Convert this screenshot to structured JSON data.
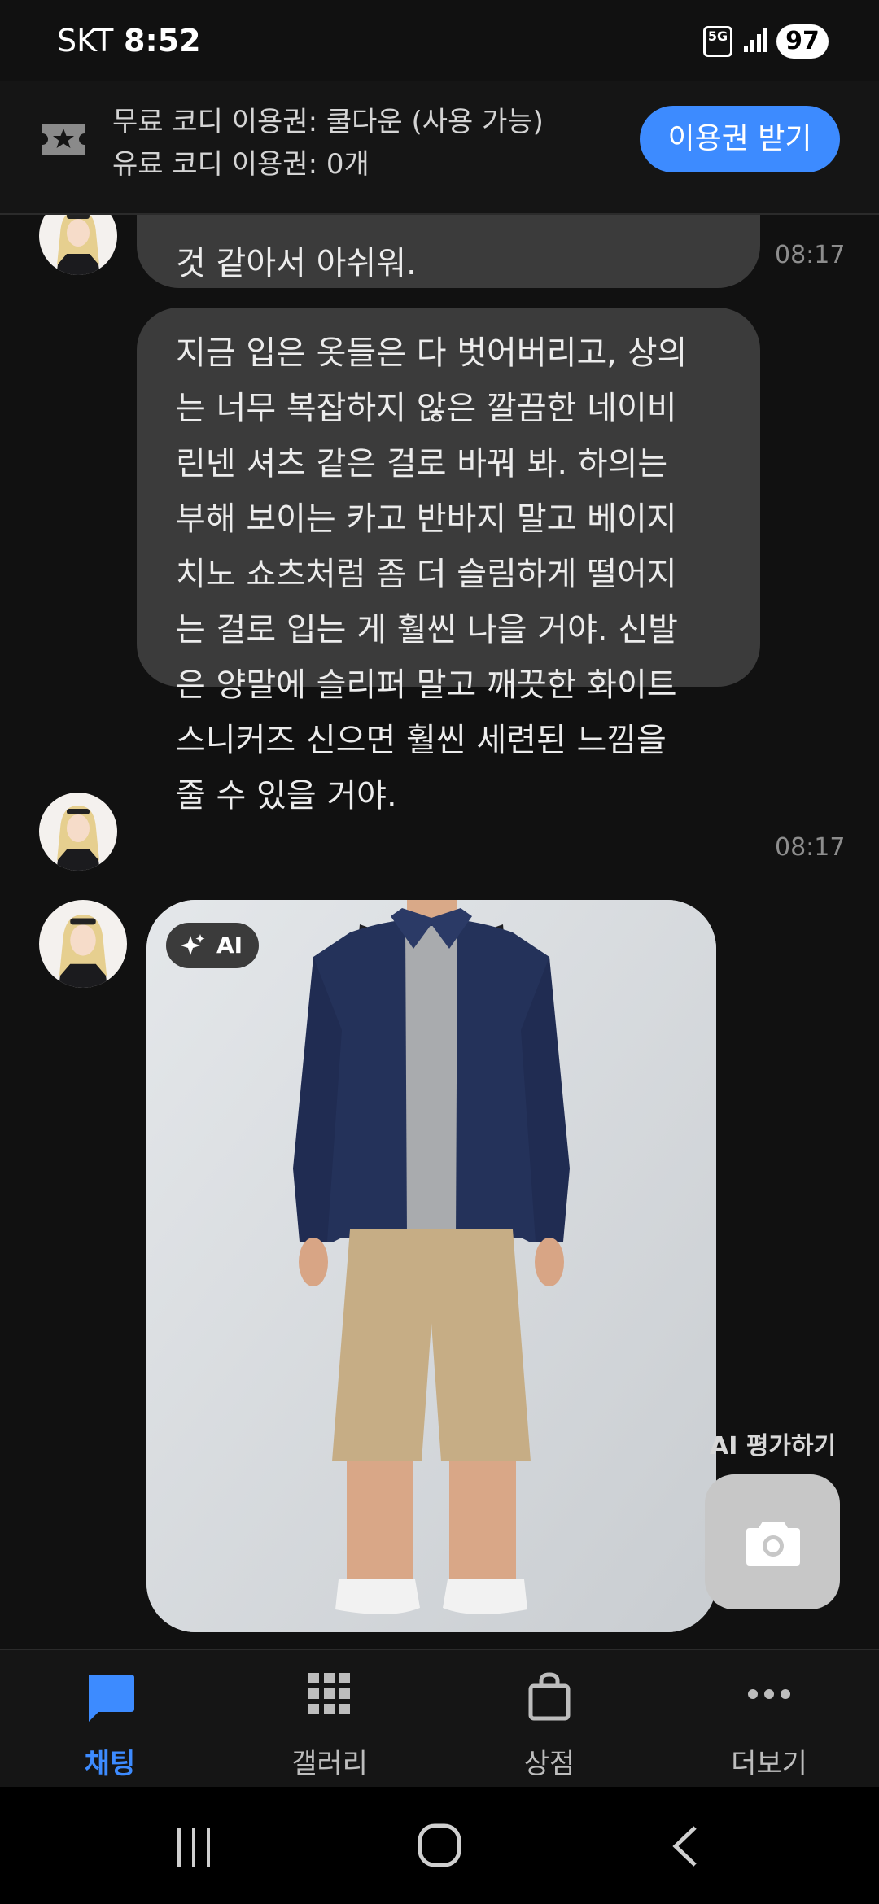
{
  "status_bar": {
    "carrier": "SKT",
    "time": "8:52",
    "network": "5G",
    "battery": "97"
  },
  "banner": {
    "free_coupon": "무료 코디 이용권: 쿨다운 (사용 가능)",
    "paid_coupon": "유료 코디 이용권: 0개",
    "get_ticket_label": "이용권 받기",
    "icon": "ticket-star-icon"
  },
  "chat": {
    "messages": [
      {
        "sender": "assistant",
        "text": "것 같아서 아쉬워.",
        "time": "08:17"
      },
      {
        "sender": "assistant",
        "text": "지금 입은 옷들은 다 벗어버리고, 상의\n는 너무 복잡하지 않은 깔끔한 네이비\n린넨 셔츠 같은 걸로 바꿔 봐. 하의는\n부해 보이는 카고 반바지 말고 베이지\n치노 쇼츠처럼 좀 더 슬림하게 떨어지\n는 걸로 입는 게 훨씬 나을 거야. 신발\n은 양말에 슬리퍼 말고 깨끗한 화이트\n스니커즈 신으면 훨씬 세련된 느낌을\n줄 수 있을 거야.",
        "time": "08:17"
      },
      {
        "sender": "assistant",
        "type": "image",
        "badge": "AI"
      }
    ],
    "ai_eval_label": "AI 평가하기",
    "camera_icon": "camera-icon"
  },
  "bottom_nav": {
    "items": [
      {
        "label": "채팅",
        "icon": "chat-icon",
        "active": true
      },
      {
        "label": "갤러리",
        "icon": "grid-icon",
        "active": false
      },
      {
        "label": "상점",
        "icon": "shopping-bag-icon",
        "active": false
      },
      {
        "label": "더보기",
        "icon": "more-icon",
        "active": false
      }
    ]
  },
  "colors": {
    "accent": "#3d8bff",
    "background": "#111111",
    "bubble": "#3b3b3b"
  }
}
